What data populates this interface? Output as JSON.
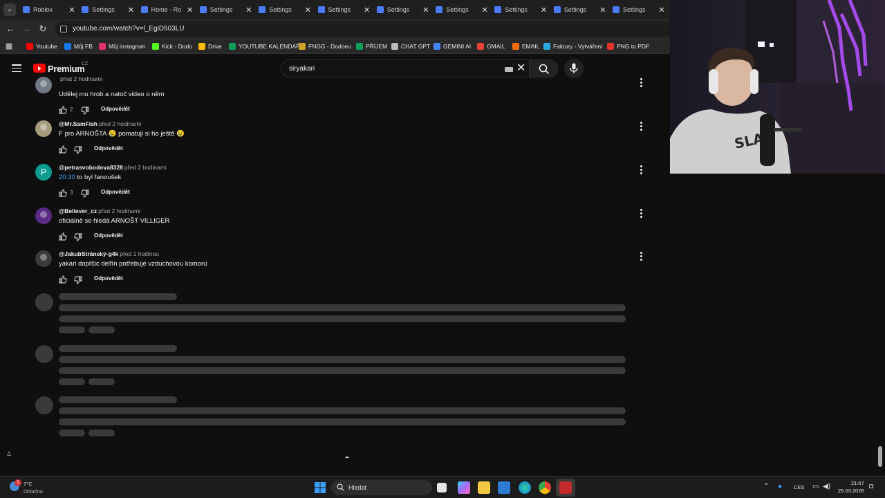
{
  "browser": {
    "tabs": [
      {
        "title": "Roblox",
        "icon_color": "#4b7bff"
      },
      {
        "title": "Settings",
        "icon_color": "#4b7bff"
      },
      {
        "title": "Home - Ro",
        "icon_color": "#4b7bff"
      },
      {
        "title": "Settings",
        "icon_color": "#4b7bff"
      },
      {
        "title": "Settings",
        "icon_color": "#4b7bff"
      },
      {
        "title": "Settings",
        "icon_color": "#4b7bff"
      },
      {
        "title": "Settings",
        "icon_color": "#4b7bff"
      },
      {
        "title": "Settings",
        "icon_color": "#4b7bff"
      },
      {
        "title": "Settings",
        "icon_color": "#4b7bff"
      },
      {
        "title": "Settings",
        "icon_color": "#4b7bff"
      },
      {
        "title": "Settings",
        "icon_color": "#4b7bff"
      }
    ],
    "url": "youtube.com/watch?v=l_EgiD503LU",
    "bookmarks": [
      {
        "label": "Youtube",
        "color": "#ff0000"
      },
      {
        "label": "Můj FB",
        "color": "#1877f2"
      },
      {
        "label": "Můj instagram",
        "color": "#e1306c"
      },
      {
        "label": "Kick - Dodo",
        "color": "#53fc18"
      },
      {
        "label": "Drive",
        "color": "#fbbc04"
      },
      {
        "label": "YOUTUBE KALENDÁŘ",
        "color": "#0f9d58"
      },
      {
        "label": "FNGG - Dodoeu",
        "color": "#c9a227"
      },
      {
        "label": "PŘÍJEM",
        "color": "#0f9d58"
      },
      {
        "label": "CHAT GPT",
        "color": "#bbbbbb"
      },
      {
        "label": "GEMINI AI",
        "color": "#4285f4"
      },
      {
        "label": "GMAIL",
        "color": "#ea4335"
      },
      {
        "label": "EMAIL",
        "color": "#ff6a00"
      },
      {
        "label": "Faktury - Vytváření",
        "color": "#29a8e0"
      },
      {
        "label": "PNG to PDF",
        "color": "#e5322d"
      }
    ]
  },
  "youtube": {
    "brand": "Premium",
    "country": "CZ",
    "search_query": "siryakari"
  },
  "comments": [
    {
      "author": "",
      "time": "před 2 hodinami",
      "text": "Udělej mu hrob a natoč video o něm",
      "timestamp": "",
      "likes": "2",
      "reply_label": "Odpovědět",
      "avatar_color": "#6f7a86"
    },
    {
      "author": "@Mr.SamFish",
      "time": "před 2 hodinami",
      "text": "F pro ARNOŠTA 😢 pomatuji si ho ještě 😢",
      "timestamp": "",
      "likes": "",
      "reply_label": "Odpovědět",
      "avatar_color": "#a59c7e"
    },
    {
      "author": "@petrasvobodova8328",
      "time": "před 2 hodinami",
      "text": " to byl fanoušek",
      "timestamp": "20:30",
      "likes": "3",
      "reply_label": "Odpovědět",
      "avatar_color": "#0b9e8f",
      "avatar_letter": "P"
    },
    {
      "author": "@Believer_cz",
      "time": "před 2 hodinami",
      "text": "oficiálně se hledá ARNOŠT VILLIGER",
      "timestamp": "",
      "likes": "",
      "reply_label": "Odpovědět",
      "avatar_color": "#5b2a86"
    },
    {
      "author": "@JakubStránský-g4k",
      "time": "před 1 hodinou",
      "text": "yakari dopřčic delfín potřebuje vzduchovou komoru",
      "timestamp": "",
      "likes": "",
      "reply_label": "Odpovědět",
      "avatar_color": "#3b3b3b"
    }
  ],
  "taskbar": {
    "weather_temp": "7°C",
    "weather_desc": "Oblačno",
    "weather_badge": "1",
    "search_placeholder": "Hledat",
    "language": "CES",
    "time": "21:07",
    "date": "25.03.2026"
  }
}
